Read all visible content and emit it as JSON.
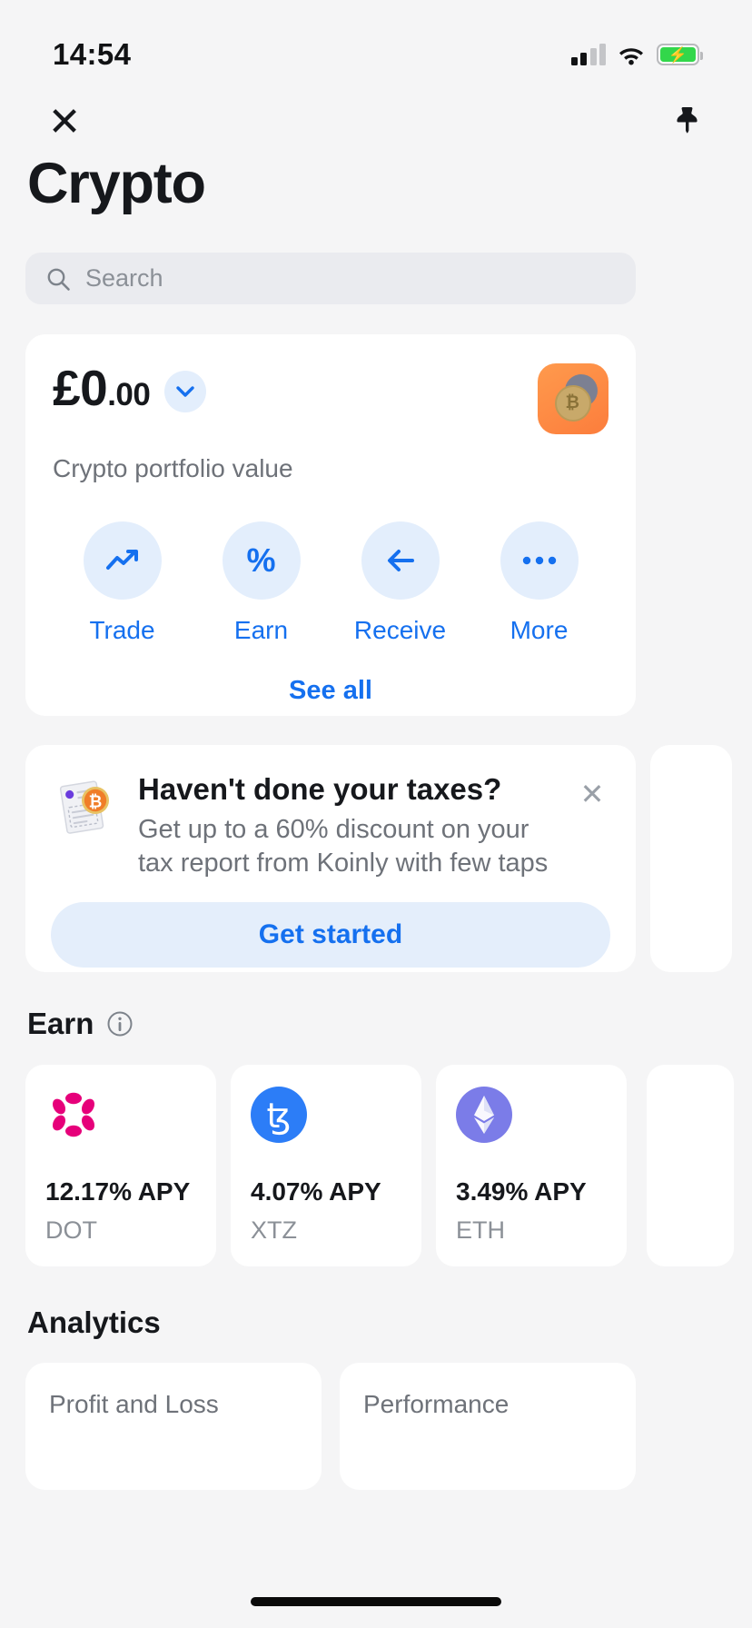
{
  "status_bar": {
    "time": "14:54",
    "signal_icon": "cellular-signal-icon",
    "wifi_icon": "wifi-icon",
    "battery_icon": "battery-charging-icon",
    "battery_color": "#32d74b"
  },
  "nav": {
    "close_icon": "close-icon",
    "pin_icon": "pin-icon"
  },
  "header": {
    "title": "Crypto"
  },
  "search": {
    "placeholder": "Search",
    "value": "",
    "icon": "search-icon"
  },
  "portfolio": {
    "currency_symbol": "£",
    "amount_whole": "£0",
    "amount_decimal": ".00",
    "amount_full": "£0.00",
    "subtitle": "Crypto portfolio value",
    "chevron_icon": "chevron-down-icon",
    "coin_badge_icon": "crypto-coins-icon",
    "accent_color": "#1570ef",
    "actions": [
      {
        "label": "Trade",
        "icon": "trending-up-icon"
      },
      {
        "label": "Earn",
        "icon": "percent-icon"
      },
      {
        "label": "Receive",
        "icon": "arrow-left-icon"
      },
      {
        "label": "More",
        "icon": "ellipsis-icon"
      }
    ],
    "see_all_label": "See all"
  },
  "tax_banner": {
    "icon": "tax-document-bitcoin-icon",
    "title": "Haven't done your taxes?",
    "description": "Get up to a 60% discount on your tax report from Koinly with few taps",
    "cta_label": "Get started",
    "close_icon": "close-icon"
  },
  "earn": {
    "section_title": "Earn",
    "info_icon": "info-circle-icon",
    "cards": [
      {
        "apy": "12.17% APY",
        "symbol": "DOT",
        "logo": "polkadot-logo-icon",
        "color": "#e6007a"
      },
      {
        "apy": "4.07% APY",
        "symbol": "XTZ",
        "logo": "tezos-logo-icon",
        "color": "#2c7df7"
      },
      {
        "apy": "3.49% APY",
        "symbol": "ETH",
        "logo": "ethereum-logo-icon",
        "color": "#7b7ce8"
      }
    ]
  },
  "analytics": {
    "section_title": "Analytics",
    "cards": [
      {
        "title": "Profit and Loss"
      },
      {
        "title": "Performance"
      }
    ]
  }
}
